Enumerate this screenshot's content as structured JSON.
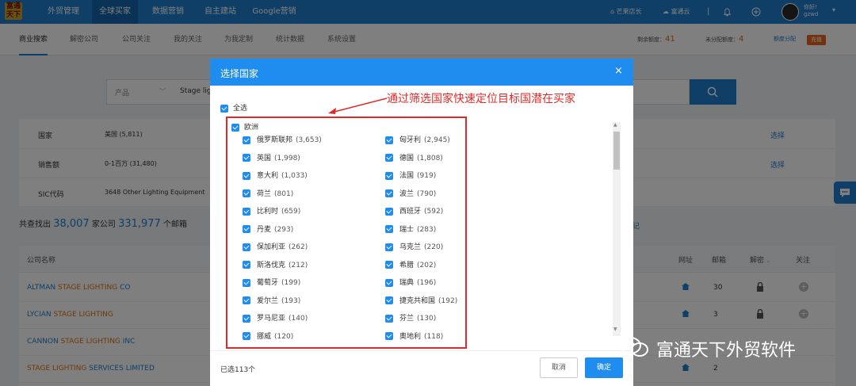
{
  "logo": {
    "text": "富通天下"
  },
  "topnav": {
    "items": [
      "外贸管理",
      "全球买家",
      "数据营销",
      "自主建站",
      "Google营销"
    ],
    "right": {
      "store": "芒果店长",
      "cloud": "富通云",
      "user_line1": "你好!",
      "user_line2": "gzwd"
    }
  },
  "subnav": {
    "items": [
      "商业搜索",
      "解密公司",
      "公司关注",
      "我的关注",
      "为我定制",
      "统计数据",
      "系统设置"
    ],
    "quota_remaining_label": "剩余额度：",
    "quota_remaining": "41",
    "quota_unassigned_label": "未分配额度：",
    "quota_unassigned": "4",
    "quota_assign": "额度分配",
    "recharge": "充值"
  },
  "search": {
    "category": "产品",
    "value": "Stage lig"
  },
  "filters": [
    {
      "label": "国家",
      "value": "美国 (5,811)",
      "link": "选择"
    },
    {
      "label": "销售额",
      "value": "0-1百万 (31,480)",
      "link": "选择"
    },
    {
      "label": "SIC代码",
      "value": "3648 Other Lighting Equipment",
      "link": ""
    }
  ],
  "summary": {
    "prefix": "共查找出",
    "companies": "38,007",
    "mid": "家公司",
    "emails": "331,977",
    "suffix": "个邮箱",
    "right_link": "记"
  },
  "table": {
    "headers": [
      "公司名称",
      "网址",
      "邮箱",
      "解密",
      "关注"
    ],
    "rows": [
      {
        "pre": "ALTMAN ",
        "hl": "STAGE LIGHTING",
        "post": " CO",
        "emails": "30"
      },
      {
        "pre": "LYCIAN ",
        "hl": "STAGE LIGHTING",
        "post": "",
        "emails": "3"
      },
      {
        "pre": "CANNON ",
        "hl": "STAGE LIGHTING",
        "post": " INC",
        "emails": ""
      },
      {
        "pre": "",
        "hl": "STAGE LIGHTING",
        "post": " SERVICES LIMITED",
        "emails": "2"
      }
    ]
  },
  "modal": {
    "title": "选择国家",
    "close": "×",
    "select_all": "全选",
    "continent": "欧洲",
    "countries_left": [
      {
        "name": "俄罗斯联邦",
        "count": "(3,653)"
      },
      {
        "name": "英国",
        "count": "(1,998)"
      },
      {
        "name": "意大利",
        "count": "(1,033)"
      },
      {
        "name": "荷兰",
        "count": "(801)"
      },
      {
        "name": "比利时",
        "count": "(659)"
      },
      {
        "name": "丹麦",
        "count": "(293)"
      },
      {
        "name": "保加利亚",
        "count": "(262)"
      },
      {
        "name": "斯洛伐克",
        "count": "(212)"
      },
      {
        "name": "葡萄牙",
        "count": "(199)"
      },
      {
        "name": "爱尔兰",
        "count": "(193)"
      },
      {
        "name": "罗马尼亚",
        "count": "(140)"
      },
      {
        "name": "挪威",
        "count": "(120)"
      }
    ],
    "countries_right": [
      {
        "name": "匈牙利",
        "count": "(2,945)"
      },
      {
        "name": "德国",
        "count": "(1,808)"
      },
      {
        "name": "法国",
        "count": "(919)"
      },
      {
        "name": "波兰",
        "count": "(790)"
      },
      {
        "name": "西班牙",
        "count": "(592)"
      },
      {
        "name": "瑞士",
        "count": "(283)"
      },
      {
        "name": "乌克兰",
        "count": "(220)"
      },
      {
        "name": "希腊",
        "count": "(202)"
      },
      {
        "name": "瑞典",
        "count": "(196)"
      },
      {
        "name": "捷克共和国",
        "count": "(192)"
      },
      {
        "name": "芬兰",
        "count": "(130)"
      },
      {
        "name": "奥地利",
        "count": "(118)"
      }
    ],
    "selected": "已选113个",
    "cancel": "取消",
    "ok": "确定"
  },
  "annotation": "通过筛选国家快速定位目标国潜在买家",
  "watermark": "富通天下外贸软件",
  "colors": {
    "primary": "#1f7fce",
    "modal_header": "#1f8cf0",
    "annotation": "#e02a2a",
    "highlight": "#e07010"
  },
  "icons": [
    "search-icon",
    "bell-icon",
    "plus-circle-icon",
    "cloud-icon",
    "lock-icon",
    "home-icon",
    "chat-icon",
    "wechat-icon"
  ]
}
